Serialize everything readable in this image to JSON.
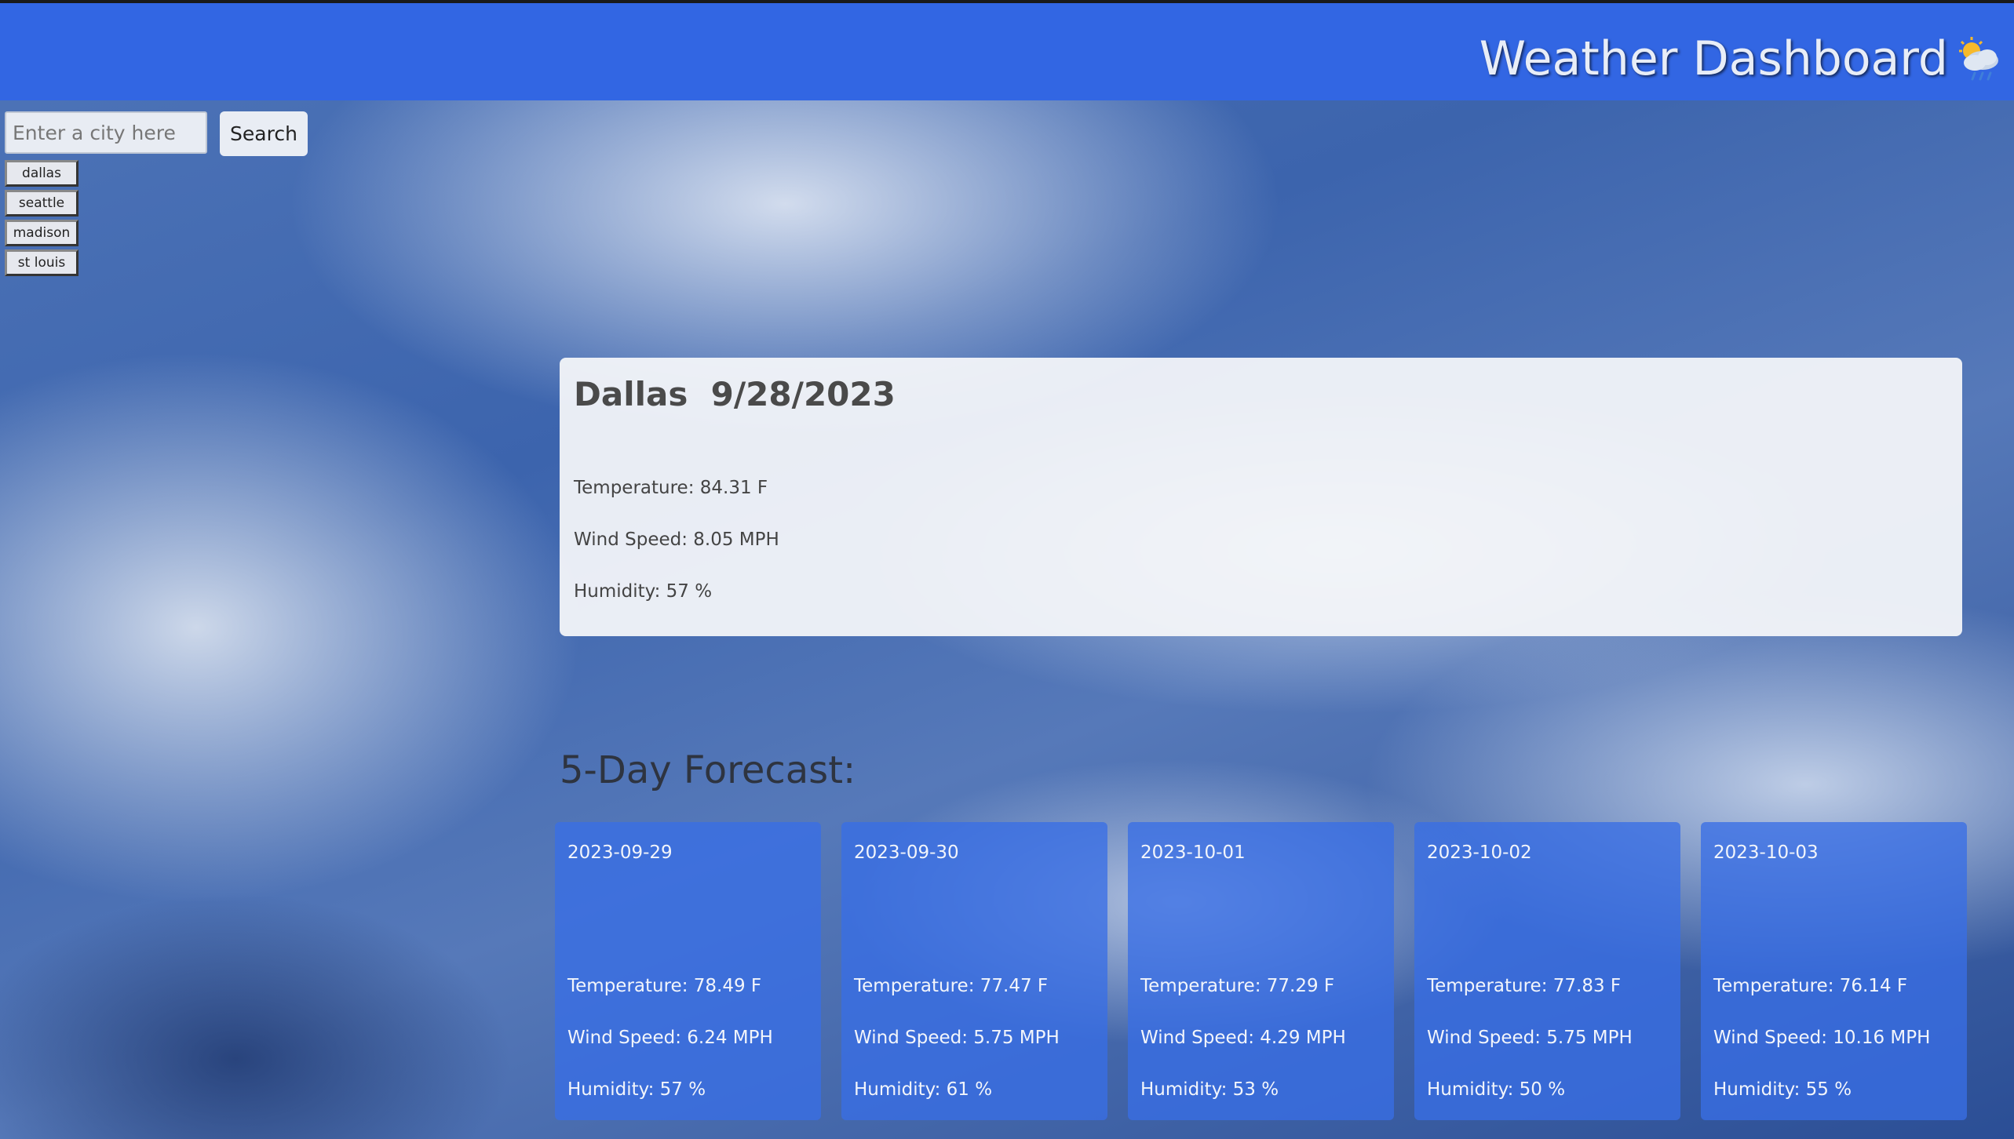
{
  "app": {
    "title": "Weather Dashboard",
    "title_icon": "sun-cloud-rain-icon"
  },
  "search": {
    "placeholder": "Enter a city here",
    "value": "",
    "button_label": "Search"
  },
  "history": [
    "dallas",
    "seattle",
    "madison",
    "st louis"
  ],
  "current": {
    "city": "Dallas",
    "date": "9/28/2023",
    "temperature": "Temperature: 84.31 F",
    "wind": "Wind Speed: 8.05 MPH",
    "humidity": "Humidity: 57 %"
  },
  "forecast": {
    "heading": "5-Day Forecast:",
    "days": [
      {
        "date": "2023-09-29",
        "temperature": "Temperature: 78.49 F",
        "wind": "Wind Speed: 6.24 MPH",
        "humidity": "Humidity: 57 %"
      },
      {
        "date": "2023-09-30",
        "temperature": "Temperature: 77.47 F",
        "wind": "Wind Speed: 5.75 MPH",
        "humidity": "Humidity: 61 %"
      },
      {
        "date": "2023-10-01",
        "temperature": "Temperature: 77.29 F",
        "wind": "Wind Speed: 4.29 MPH",
        "humidity": "Humidity: 53 %"
      },
      {
        "date": "2023-10-02",
        "temperature": "Temperature: 77.83 F",
        "wind": "Wind Speed: 5.75 MPH",
        "humidity": "Humidity: 50 %"
      },
      {
        "date": "2023-10-03",
        "temperature": "Temperature: 76.14 F",
        "wind": "Wind Speed: 10.16 MPH",
        "humidity": "Humidity: 55 %"
      }
    ]
  },
  "colors": {
    "header": "#3266e3",
    "forecast_card": "#386ee6"
  }
}
